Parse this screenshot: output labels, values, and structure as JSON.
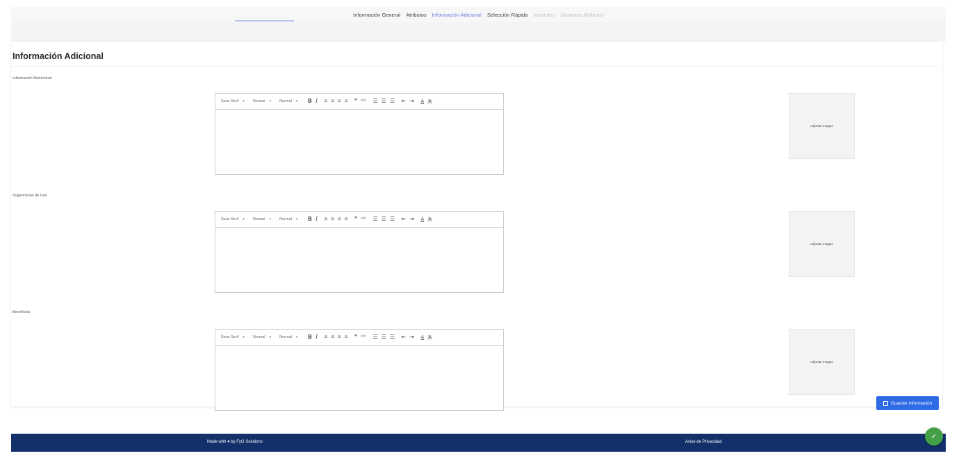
{
  "tabs": [
    {
      "label": "Información General",
      "state": "normal"
    },
    {
      "label": "Atributos",
      "state": "normal"
    },
    {
      "label": "Información Adicional",
      "state": "active"
    },
    {
      "label": "Selección Rápida",
      "state": "normal"
    },
    {
      "label": "Variantes",
      "state": "disabled"
    },
    {
      "label": "Variantes Atributos",
      "state": "disabled"
    }
  ],
  "page": {
    "title": "Información Adicional"
  },
  "toolbar": {
    "font": "Sans Serif",
    "size": "Normal",
    "header": "Normal",
    "bold_glyph": "B",
    "italic_glyph": "I",
    "align_glyphs": [
      "≡",
      "≡",
      "≡",
      "≡"
    ],
    "blockquote_glyph": "❞",
    "code_glyph": "</>",
    "list_glyphs": [
      "☰",
      "☰",
      "☰"
    ],
    "indent_glyphs": [
      "⇤",
      "⇥"
    ],
    "color_glyph": "A",
    "background_glyph": "A",
    "caret_glyph": "▾"
  },
  "sections": [
    {
      "label": "Información Nutricional",
      "attach_label": "Adjuntar Imagen"
    },
    {
      "label": "Sugerencias de Uso",
      "attach_label": "Adjuntar Imagen"
    },
    {
      "label": "Beneficios",
      "attach_label": "Adjuntar Imagen"
    }
  ],
  "save_button": {
    "label": "Guardar Información"
  },
  "footer": {
    "made_with": "Made with ♥ by FyG Solutions",
    "privacy": "Aviso de Privacidad"
  },
  "fab": {
    "glyph": "✓"
  },
  "colors": {
    "accent": "#6c7ce0",
    "primary": "#2f6be6",
    "footer": "#13306b",
    "success": "#43a047"
  }
}
